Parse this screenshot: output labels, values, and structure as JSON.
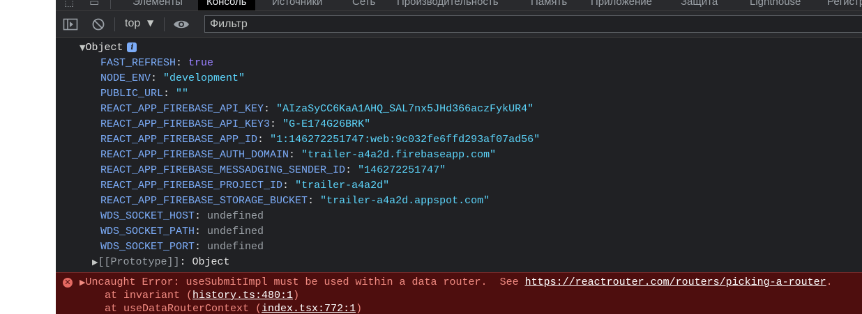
{
  "tabs": [
    {
      "label": "Элементы"
    },
    {
      "label": "Консоль"
    },
    {
      "label": "Источники"
    },
    {
      "label": "Сеть"
    },
    {
      "label": "Производительность"
    },
    {
      "label": "Память"
    },
    {
      "label": "Приложение"
    },
    {
      "label": "Защита"
    },
    {
      "label": "Lighthouse"
    },
    {
      "label": "Регистр"
    }
  ],
  "toolbar": {
    "context": "top",
    "filter_placeholder": "Фильтр"
  },
  "console": {
    "object_label": "Object",
    "entries": [
      {
        "key": "FAST_REFRESH",
        "sep": ": ",
        "value": "true",
        "kind": "bool"
      },
      {
        "key": "NODE_ENV",
        "sep": ": ",
        "value": "\"development\"",
        "kind": "str"
      },
      {
        "key": "PUBLIC_URL",
        "sep": ": ",
        "value": "\"\"",
        "kind": "str"
      },
      {
        "key": "REACT_APP_FIREBASE_API_KEY",
        "sep": ": ",
        "value": "\"AIzaSyCC6KaA1AHQ_SAL7nx5JHd366aczFykUR4\"",
        "kind": "str"
      },
      {
        "key": "REACT_APP_FIREBASE_API_KEY3",
        "sep": ": ",
        "value": "\"G-E174G26BRK\"",
        "kind": "str"
      },
      {
        "key": "REACT_APP_FIREBASE_APP_ID",
        "sep": ": ",
        "value": "\"1:146272251747:web:9c032fe6ffd293af07ad56\"",
        "kind": "str"
      },
      {
        "key": "REACT_APP_FIREBASE_AUTH_DOMAIN",
        "sep": ": ",
        "value": "\"trailer-a4a2d.firebaseapp.com\"",
        "kind": "str"
      },
      {
        "key": "REACT_APP_FIREBASE_MESSADGING_SENDER_ID",
        "sep": ": ",
        "value": "\"146272251747\"",
        "kind": "str"
      },
      {
        "key": "REACT_APP_FIREBASE_PROJECT_ID",
        "sep": ": ",
        "value": "\"trailer-a4a2d\"",
        "kind": "str"
      },
      {
        "key": "REACT_APP_FIREBASE_STORAGE_BUCKET",
        "sep": ": ",
        "value": "\"trailer-a4a2d.appspot.com\"",
        "kind": "str"
      },
      {
        "key": "WDS_SOCKET_HOST",
        "sep": ": ",
        "value": "undefined",
        "kind": "undef"
      },
      {
        "key": "WDS_SOCKET_PATH",
        "sep": ": ",
        "value": "undefined",
        "kind": "undef"
      },
      {
        "key": "WDS_SOCKET_PORT",
        "sep": ": ",
        "value": "undefined",
        "kind": "undef"
      }
    ],
    "prototype": {
      "key": "[[Prototype]]",
      "sep": ": ",
      "value": "Object"
    }
  },
  "error": {
    "message": "Uncaught Error: useSubmitImpl must be used within a data router.  See ",
    "link": "https://reactrouter.com/routers/picking-a-router",
    "suffix": ".",
    "stack": [
      {
        "prefix": "at invariant (",
        "link": "history.ts:480:1",
        "suffix": ")"
      },
      {
        "prefix": "at useDataRouterContext (",
        "link": "index.tsx:772:1",
        "suffix": ")"
      }
    ]
  }
}
